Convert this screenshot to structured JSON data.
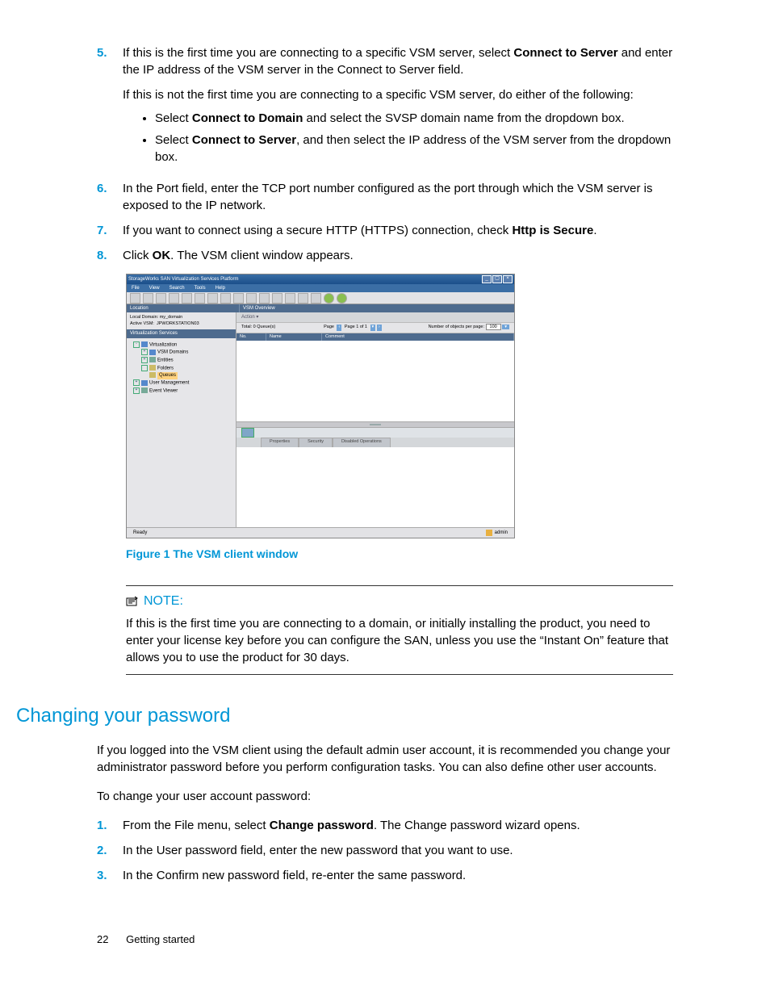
{
  "steps_a": {
    "s5": {
      "num": "5.",
      "p1a": "If this is the first time you are connecting to a specific VSM server, select ",
      "p1b": "Connect to Server",
      "p1c": " and enter the IP address of the VSM server in the Connect to Server field.",
      "p2": "If this is not the first time you are connecting to a specific VSM server, do either of the following:",
      "b1a": "Select ",
      "b1b": "Connect to Domain",
      "b1c": " and select the SVSP domain name from the dropdown box.",
      "b2a": "Select ",
      "b2b": "Connect to Server",
      "b2c": ", and then select the IP address of the VSM server from the dropdown box."
    },
    "s6": {
      "num": "6.",
      "t": "In the Port field, enter the TCP port number configured as the port through which the VSM server is exposed to the IP network."
    },
    "s7": {
      "num": "7.",
      "t1": "If you want to connect using a secure HTTP (HTTPS) connection, check ",
      "t2": "Http is Secure",
      "t3": "."
    },
    "s8": {
      "num": "8.",
      "t1": "Click ",
      "t2": "OK",
      "t3": ". The VSM client window appears."
    }
  },
  "shot": {
    "title": "StorageWorks SAN Virtualization Services Platform",
    "menus": [
      "File",
      "View",
      "Search",
      "Tools",
      "Help"
    ],
    "loc_label": "Location",
    "overview_label": "VSM Overview",
    "local_domain_label": "Local Domain:",
    "local_domain_value": "my_domain",
    "active_vsm_label": "Active VSM:",
    "active_vsm_value": "JPWORKSTATION03",
    "vs_label": "Virtualization Services",
    "tree": {
      "n1": "Virtualization",
      "n2": "VSM Domains",
      "n3": "Entities",
      "n4": "Folders",
      "n5": "Queues",
      "n6": "User Management",
      "n7": "Event Viewer"
    },
    "action": "Action ▾",
    "total": "Total: 0 Queue(s)",
    "page_label": "Page",
    "page_of": "Page 1 of 1",
    "objs_label": "Number of objects per page:",
    "objs_val": "100",
    "cols": {
      "c1": "No.",
      "c2": "Name",
      "c3": "Comment"
    },
    "tabs": {
      "t1": "Properties",
      "t2": "Security",
      "t3": "Disabled Operations"
    },
    "status": "Ready",
    "user": "admin"
  },
  "fig_caption": "Figure 1 The VSM client window",
  "note": {
    "head": "NOTE:",
    "body": "If this is the first time you are connecting to a domain, or initially installing the product, you need to enter your license key before you can configure the SAN, unless you use the “Instant On” feature that allows you to use the product for 30 days."
  },
  "section": "Changing your password",
  "sec_p1": "If you logged into the VSM client using the default admin user account, it is recommended you change your administrator password before you perform configuration tasks. You can also define other user accounts.",
  "sec_p2": "To change your user account password:",
  "steps_b": {
    "s1": {
      "num": "1.",
      "t1": "From the File menu, select ",
      "t2": "Change password",
      "t3": ". The Change password wizard opens."
    },
    "s2": {
      "num": "2.",
      "t": "In the User password field, enter the new password that you want to use."
    },
    "s3": {
      "num": "3.",
      "t": "In the Confirm new password field, re-enter the same password."
    }
  },
  "footer": {
    "page": "22",
    "chapter": "Getting started"
  }
}
